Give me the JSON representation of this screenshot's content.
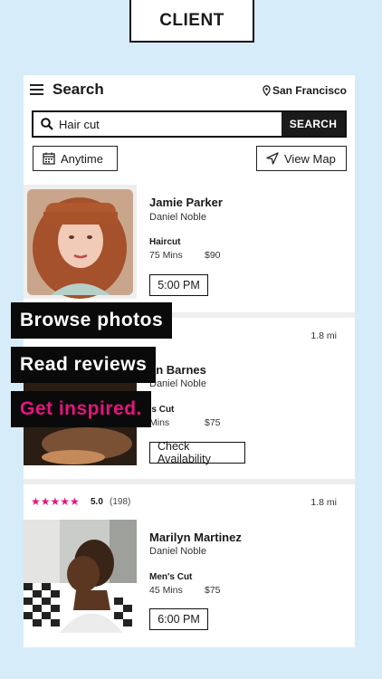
{
  "badge": "CLIENT",
  "topbar": {
    "title": "Search",
    "location": "San Francisco"
  },
  "search": {
    "value": "Hair cut",
    "button": "SEARCH"
  },
  "filters": {
    "time": "Anytime",
    "map": "View Map"
  },
  "results": [
    {
      "name": "Jamie Parker",
      "salon": "Daniel Noble",
      "service": "Haircut",
      "duration": "75 Mins",
      "price": "$90",
      "action": "5:00 PM"
    },
    {
      "rating": "",
      "reviews": "",
      "distance": "1.8 mi",
      "name": "an Barnes",
      "salon": "Daniel Noble",
      "service": "'s Cut",
      "duration": "Mins",
      "price": "$75",
      "action": "Check Availability"
    },
    {
      "stars": "★★★★★",
      "rating": "5.0",
      "reviews": "(198)",
      "distance": "1.8 mi",
      "name": "Marilyn Martinez",
      "salon": "Daniel Noble",
      "service": "Men's Cut",
      "duration": "45 Mins",
      "price": "$75",
      "action": "6:00 PM"
    }
  ],
  "overlays": [
    "Browse photos",
    "Read reviews",
    "Get inspired."
  ],
  "colors": {
    "accent": "#e5157e",
    "background": "#d6ecf8"
  }
}
